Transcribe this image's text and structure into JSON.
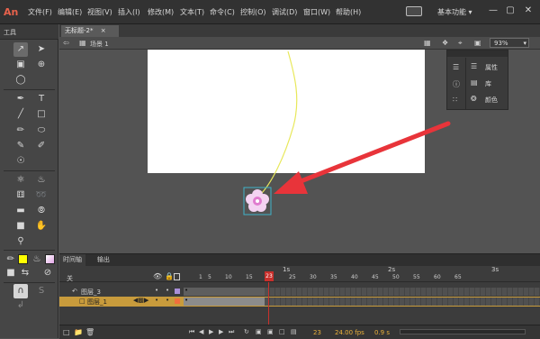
{
  "app": {
    "logo": "An"
  },
  "menu": [
    "文件(F)",
    "编辑(E)",
    "视图(V)",
    "插入(I)",
    "修改(M)",
    "文本(T)",
    "命令(C)",
    "控制(O)",
    "调试(D)",
    "窗口(W)",
    "帮助(H)"
  ],
  "workspace": {
    "label": "基本功能",
    "arrow": "▾"
  },
  "window_controls": {
    "minimize": "—",
    "maximize": "▢",
    "close": "✕"
  },
  "tools_panel": {
    "title": "工具"
  },
  "document": {
    "tab_title": "无标题-2*",
    "tab_close": "×",
    "scene_label": "场景 1",
    "zoom": "93%"
  },
  "mini_panel": {
    "properties": "属性",
    "library": "库",
    "color": "颜色"
  },
  "timeline": {
    "tabs": [
      "时间轴",
      "输出"
    ],
    "header_label": "关",
    "ruler_numbers": [
      "1",
      "5",
      "10",
      "15",
      "20",
      "25",
      "30",
      "35",
      "40",
      "45",
      "50",
      "55",
      "60",
      "65"
    ],
    "seconds": [
      "1s",
      "2s",
      "3s"
    ],
    "current_frame": "23",
    "layers": [
      {
        "name": "图层_3",
        "type": "guide"
      },
      {
        "name": "图层_1",
        "type": "normal",
        "selected": true
      }
    ],
    "bottom": {
      "frame": "23",
      "fps": "24.00 fps",
      "time": "0.9 s"
    }
  },
  "colors": {
    "accent_red": "#e8343a",
    "motion_path": "#e8e85a",
    "layer_highlight": "#c89b3c",
    "playhead": "#c9302c"
  }
}
